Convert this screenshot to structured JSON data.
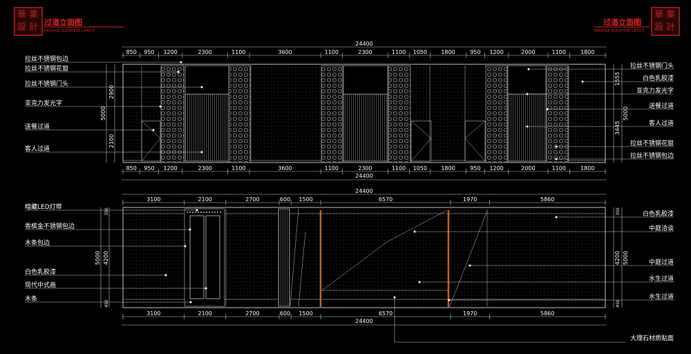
{
  "title_block": {
    "left_title": "过道立面图",
    "left_subtitle": "PASSAGE ELEVATION LAYOUT",
    "right_title": "过道立面图",
    "right_subtitle": "PASSAGE ELEVATION LAYOUT",
    "seal_chars": [
      "華",
      "業",
      "設",
      "計"
    ]
  },
  "upper_elevation": {
    "overall": "24400",
    "top_segments": [
      "850",
      "950",
      "1200",
      "2300",
      "1100",
      "3600",
      "1100",
      "2300",
      "1100",
      "1050",
      "1800",
      "950",
      "1200",
      "2000",
      "1100",
      "1800"
    ],
    "bottom_segments": [
      "850",
      "950",
      "1200",
      "2300",
      "1100",
      "3600",
      "1100",
      "2300",
      "1100",
      "1050",
      "1800",
      "950",
      "1200",
      "2000",
      "1100",
      "1800"
    ],
    "left_total": "5000",
    "left_upper": "2900",
    "left_lower": "2100",
    "right_total": "5000",
    "right_upper": "1555",
    "right_lower": "3445",
    "left_labels": [
      "拉丝不锈钢包边",
      "拉丝不锈钢花窗",
      "拉丝不锈钢门头",
      "亚克力发光字",
      "送餐过道",
      "客人过道"
    ],
    "right_labels": [
      "拉丝不锈钢门头",
      "白色乳胶漆",
      "亚克力发光字",
      "送餐过道",
      "客人过道",
      "拉丝不锈钢花窗",
      "拉丝不锈钢包边"
    ]
  },
  "lower_elevation": {
    "overall": "24400",
    "top_segments": [
      "3100",
      "2100",
      "2700",
      "600",
      "1500",
      "6570",
      "1970",
      "5860"
    ],
    "bottom_segments": [
      "3100",
      "2100",
      "2700",
      "600",
      "1500",
      "6570",
      "1970",
      "5860"
    ],
    "left_total": "5000",
    "left_mid": "4200",
    "left_top": "350",
    "left_bottom": "450",
    "right_total": "5000",
    "right_mid": "4200",
    "right_top": "350",
    "right_bottom": "450",
    "left_labels": [
      "暗藏LED灯带",
      "香槟金不锈钢包边",
      "木条包边",
      "白色乳胶漆",
      "现代中式画",
      "木条"
    ],
    "right_labels": [
      "白色乳胶漆",
      "中庭洽谈",
      "中庭过道",
      "水生过道",
      "水生过道"
    ],
    "bottom_label": "大理石材质贴面"
  },
  "colors": {
    "line": "#c8c8c8",
    "text": "#ffffff",
    "title_red": "#e02020",
    "accent_orange": "#c8641e",
    "seal_red": "#b22222"
  }
}
